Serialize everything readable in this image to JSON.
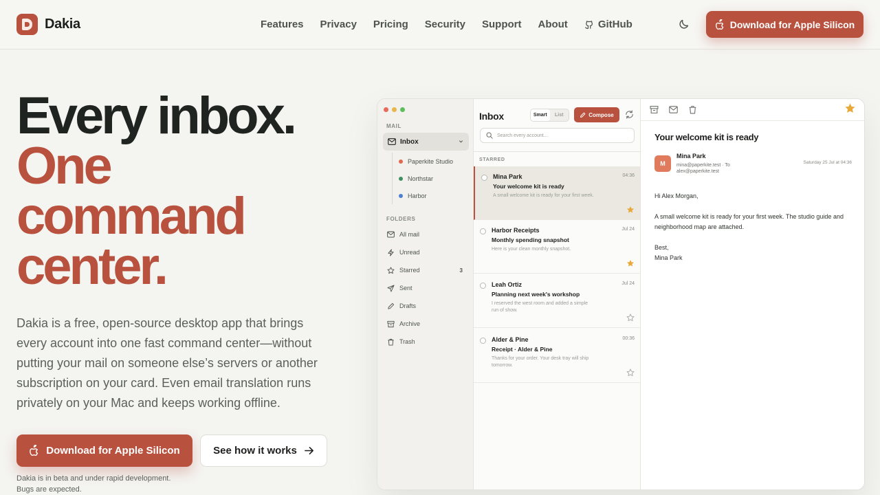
{
  "nav": {
    "brand": "Dakia",
    "links": [
      "Features",
      "Privacy",
      "Pricing",
      "Security",
      "Support",
      "About",
      "GitHub"
    ],
    "download_label": "Download for Apple Silicon"
  },
  "hero": {
    "title_line1": "Every inbox.",
    "title_line2": "One",
    "title_line3": "command",
    "title_line4": "center.",
    "description": "Dakia is a free, open-source desktop app that brings every account into one fast command center—without putting your mail on someone else’s servers or another subscription on your card. Even email translation runs privately on your Mac and keeps working offline.",
    "primary_cta": "Download for Apple Silicon",
    "secondary_cta": "See how it works",
    "beta_line1": "Dakia is in beta and under rapid development.",
    "beta_line2": "Bugs are expected."
  },
  "app": {
    "sidebar": {
      "mail_label": "MAIL",
      "inbox_label": "Inbox",
      "accounts": [
        {
          "name": "Paperkite Studio",
          "color": "#e06a4f"
        },
        {
          "name": "Northstar",
          "color": "#3f8f63"
        },
        {
          "name": "Harbor",
          "color": "#4f7fd0"
        }
      ],
      "folders_label": "FOLDERS",
      "folders": [
        {
          "name": "All mail",
          "icon": "inbox-icon",
          "count": ""
        },
        {
          "name": "Unread",
          "icon": "bolt-icon",
          "count": ""
        },
        {
          "name": "Starred",
          "icon": "star-icon",
          "count": "3"
        },
        {
          "name": "Sent",
          "icon": "send-icon",
          "count": ""
        },
        {
          "name": "Drafts",
          "icon": "pencil-icon",
          "count": ""
        },
        {
          "name": "Archive",
          "icon": "archive-icon",
          "count": ""
        },
        {
          "name": "Trash",
          "icon": "trash-icon",
          "count": ""
        }
      ]
    },
    "list": {
      "title": "Inbox",
      "view_smart": "Smart",
      "view_list": "List",
      "compose_label": "Compose",
      "search_placeholder": "Search every account...",
      "section_label": "STARRED",
      "messages": [
        {
          "from": "Mina Park",
          "time": "04:36",
          "subject": "Your welcome kit is ready",
          "snippet": "A small welcome kit is ready for your first week.",
          "starred": true,
          "selected": true
        },
        {
          "from": "Harbor Receipts",
          "time": "Jul 24",
          "subject": "Monthly spending snapshot",
          "snippet": "Here is your clean monthly snapshot.",
          "starred": true,
          "selected": false
        },
        {
          "from": "Leah Ortiz",
          "time": "Jul 24",
          "subject": "Planning next week's workshop",
          "snippet": "I reserved the west room and added a simple run of show.",
          "starred": false,
          "selected": false
        },
        {
          "from": "Alder & Pine",
          "time": "00:36",
          "subject": "Receipt · Alder & Pine",
          "snippet": "Thanks for your order. Your desk tray will ship tomorrow.",
          "starred": false,
          "selected": false
        }
      ]
    },
    "reader": {
      "subject": "Your welcome kit is ready",
      "avatar_initial": "M",
      "sender_name": "Mina Park",
      "sender_line": "mina@paperkite.test · To alex@paperkite.test",
      "date": "Saturday 25 Jul at 04:36",
      "greeting": "Hi Alex Morgan,",
      "body": "A small welcome kit is ready for your first week. The studio guide and neighborhood map are attached.",
      "signoff": "Best,",
      "signature": "Mina Park"
    }
  },
  "colors": {
    "accent": "#b9513f",
    "star": "#e8a93a"
  }
}
